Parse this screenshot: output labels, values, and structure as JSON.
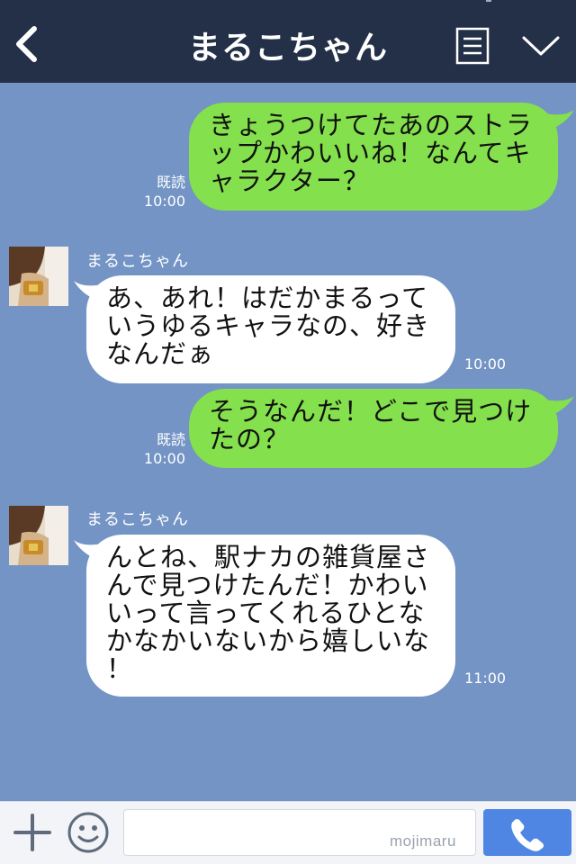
{
  "header": {
    "title": "まるこちゃん",
    "back_icon": "chevron-left-icon",
    "menu_icon": "menu-icon",
    "dropdown_icon": "chevron-down-icon"
  },
  "messages": [
    {
      "side": "mine",
      "lines": [
        "きょうつけてたあのストラ",
        "ップかわいいね！なんてキ",
        "ャラクター？"
      ],
      "read": "既読",
      "time": "10:00"
    },
    {
      "side": "theirs",
      "sender": "まるこちゃん",
      "lines": [
        "あ、あれ！はだかまるって",
        "いうゆるキャラなの、好き",
        "なんだぁ"
      ],
      "time": "10:00"
    },
    {
      "side": "mine",
      "lines": [
        "そうなんだ！どこで見つけ",
        "たの？"
      ],
      "read": "既読",
      "time": "10:00"
    },
    {
      "side": "theirs",
      "sender": "まるこちゃん",
      "lines": [
        "んとね、駅ナカの雑貨屋さ",
        "んで見つけたんだ！かわい",
        "いって言ってくれるひとな",
        "かなかいないから嬉しいな",
        "！"
      ],
      "time": "11:00"
    }
  ],
  "footer": {
    "input_value": "",
    "watermark": "mojimaru",
    "plus_icon": "plus-icon",
    "emoji_icon": "smiley-icon",
    "call_icon": "phone-icon"
  },
  "colors": {
    "header_bg": "#243047",
    "chat_bg": "#7394c4",
    "my_bubble": "#84e04c",
    "their_bubble": "#ffffff",
    "call_button": "#4f86e3"
  }
}
